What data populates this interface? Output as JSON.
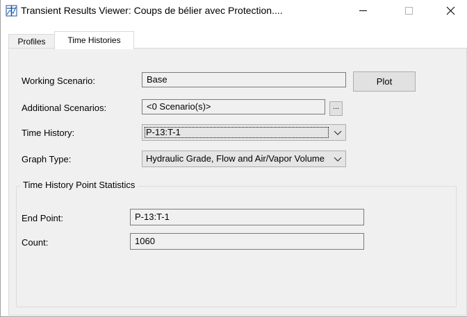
{
  "window": {
    "title": "Transient Results Viewer: Coups de bélier avec Protection....",
    "icons": {
      "app": "transient-viewer-icon",
      "minimize": "minimize-icon",
      "maximize": "maximize-icon",
      "close": "close-icon"
    }
  },
  "tabs": [
    {
      "label": "Profiles",
      "active": false
    },
    {
      "label": "Time Histories",
      "active": true
    }
  ],
  "form": {
    "working_scenario": {
      "label": "Working Scenario:",
      "value": "Base"
    },
    "plot_button": "Plot",
    "additional_scenarios": {
      "label": "Additional Scenarios:",
      "value": "<0 Scenario(s)>",
      "button": "..."
    },
    "time_history": {
      "label": "Time History:",
      "value": "P-13:T-1"
    },
    "graph_type": {
      "label": "Graph Type:",
      "value": "Hydraulic Grade, Flow and Air/Vapor Volume"
    }
  },
  "statistics": {
    "title": "Time History Point Statistics",
    "end_point": {
      "label": "End Point:",
      "value": "P-13:T-1"
    },
    "count": {
      "label": "Count:",
      "value": "1060"
    }
  },
  "colors": {
    "panel_bg": "#f0f0f0",
    "window_bg": "#ffffff",
    "border": "#7a7a7a"
  }
}
